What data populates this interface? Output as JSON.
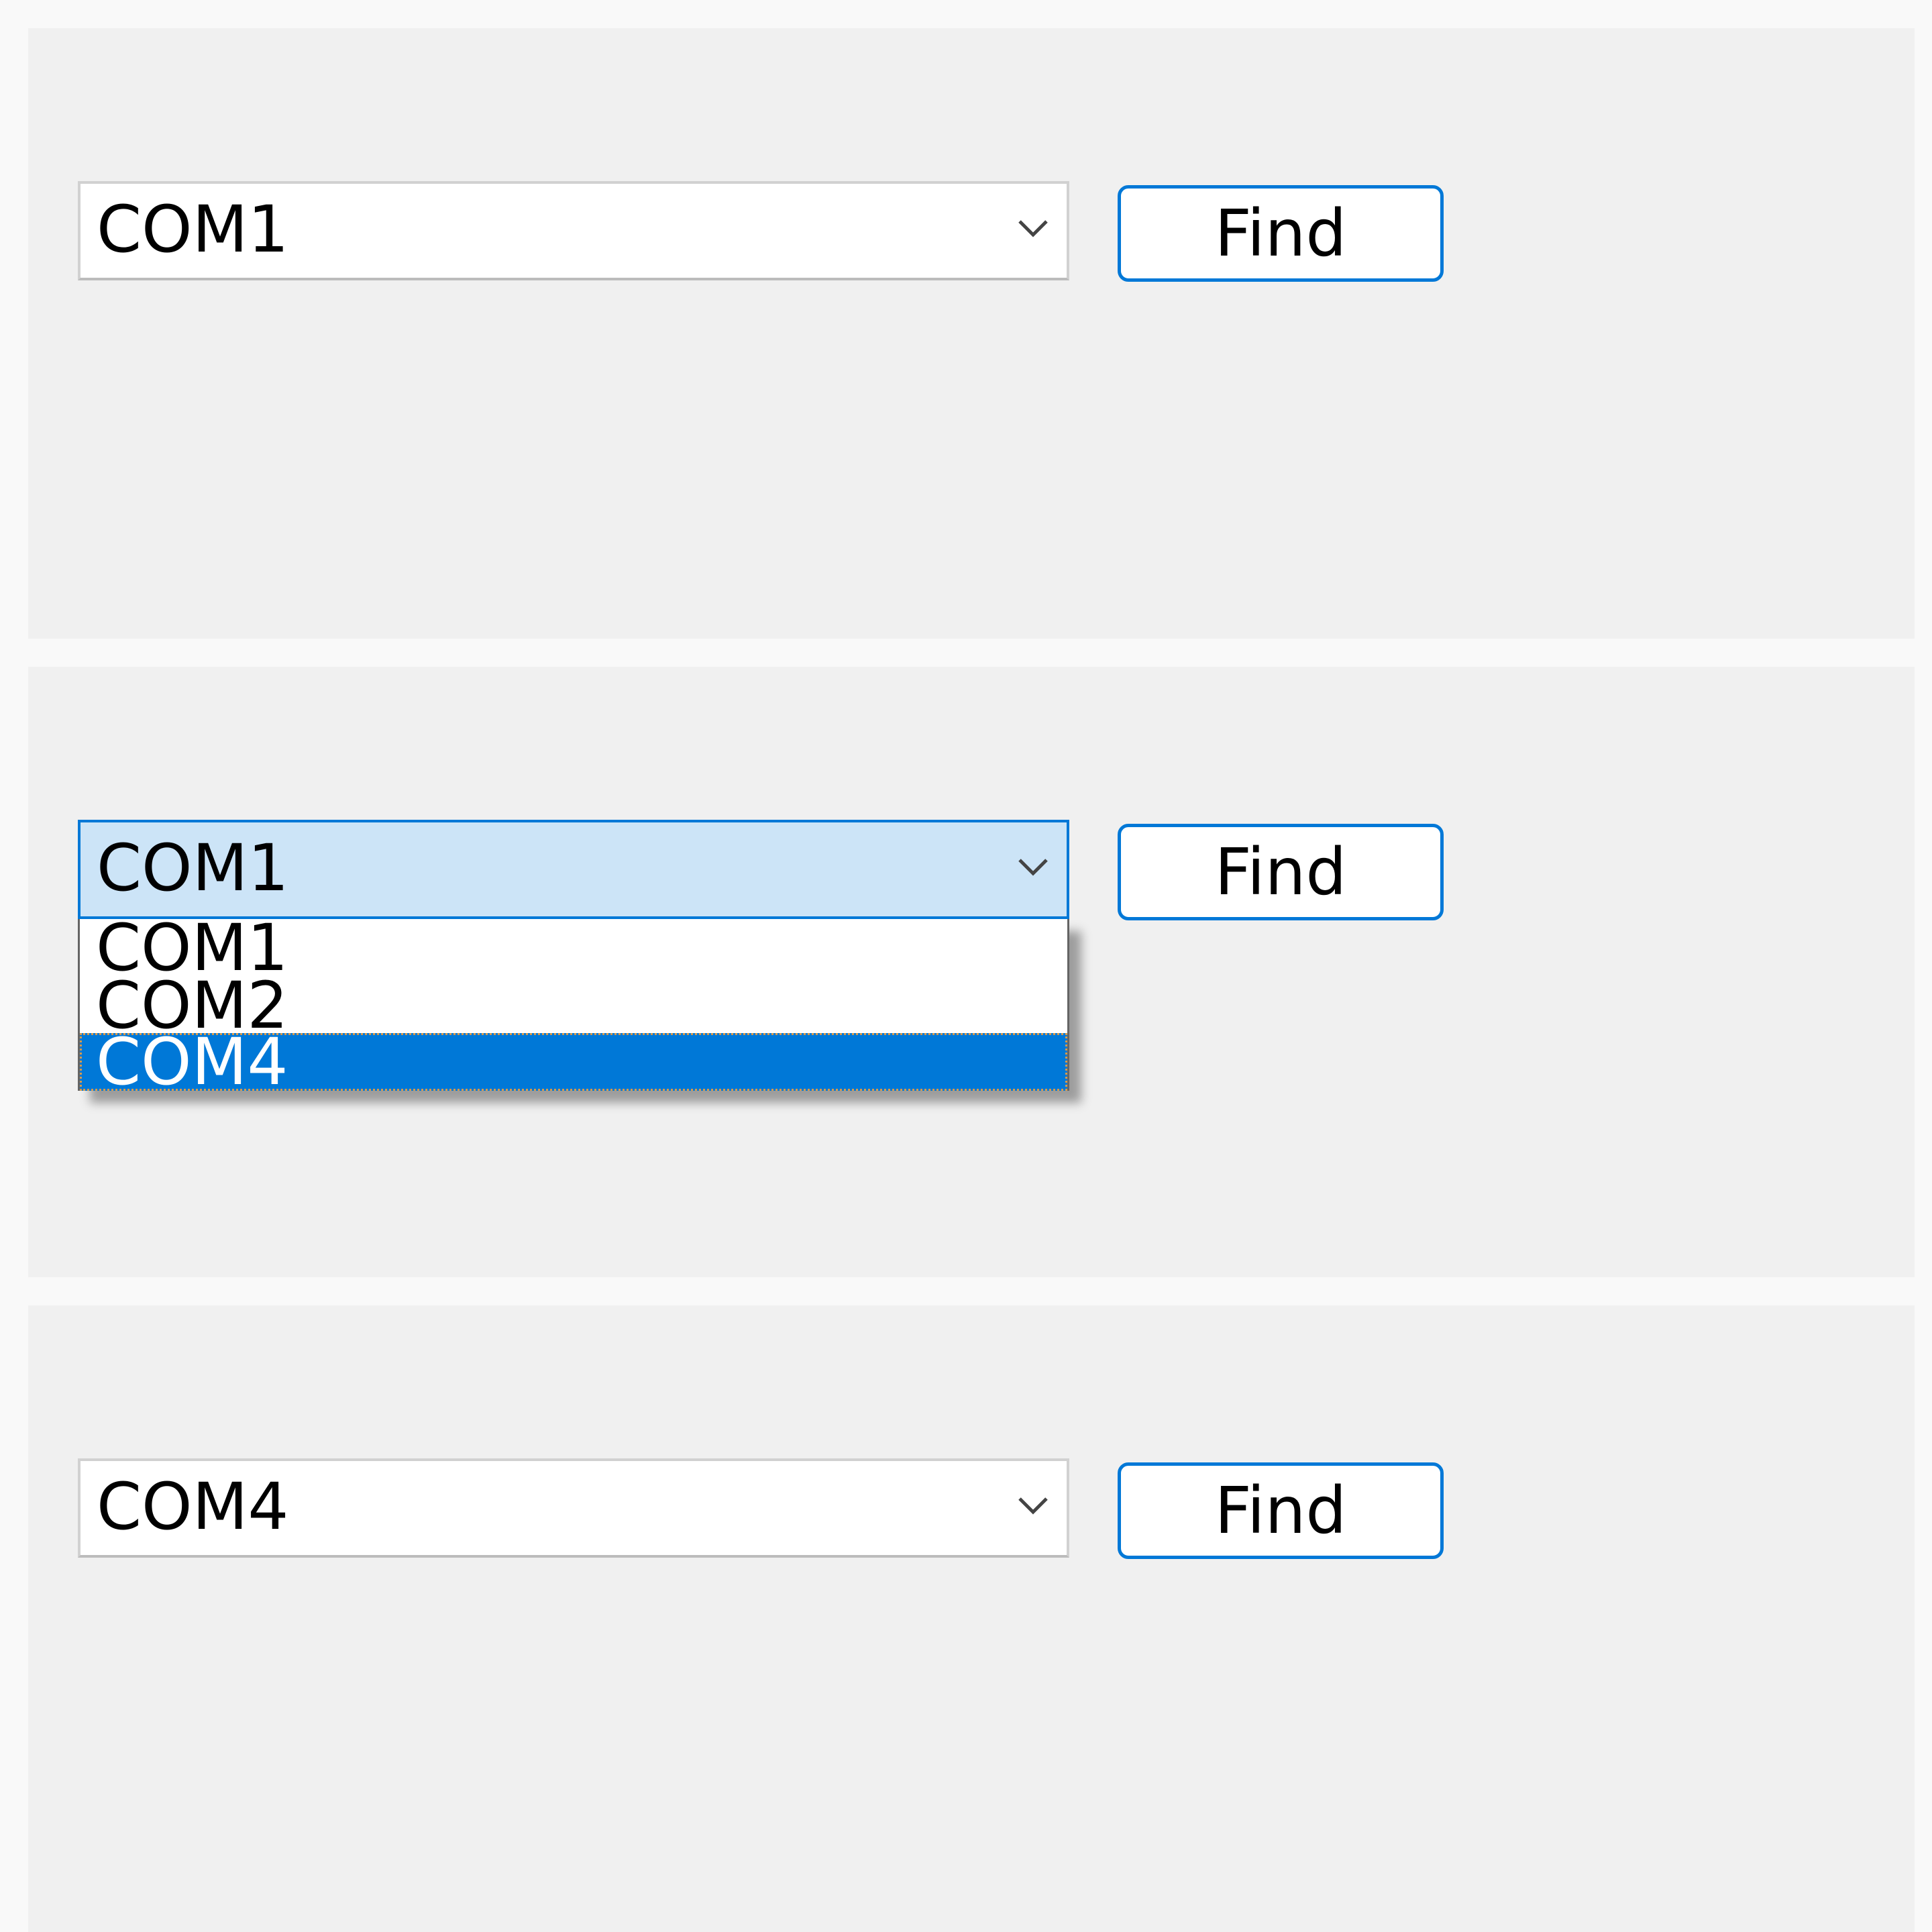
{
  "panels": [
    {
      "combo": {
        "value": "COM1",
        "state": "collapsed"
      },
      "find_label": "Find"
    },
    {
      "combo": {
        "value": "COM1",
        "state": "expanded",
        "options": [
          "COM1",
          "COM2",
          "COM4"
        ],
        "highlighted_option": "COM4"
      },
      "find_label": "Find"
    },
    {
      "combo": {
        "value": "COM4",
        "state": "collapsed"
      },
      "find_label": "Find"
    }
  ],
  "icons": {
    "dropdown": "chevron-down-icon"
  },
  "colors": {
    "accent": "#0078d7",
    "focus_fill": "#cce4f7",
    "panel_bg": "#f0f0f0",
    "page_bg": "#f9f9f9"
  }
}
